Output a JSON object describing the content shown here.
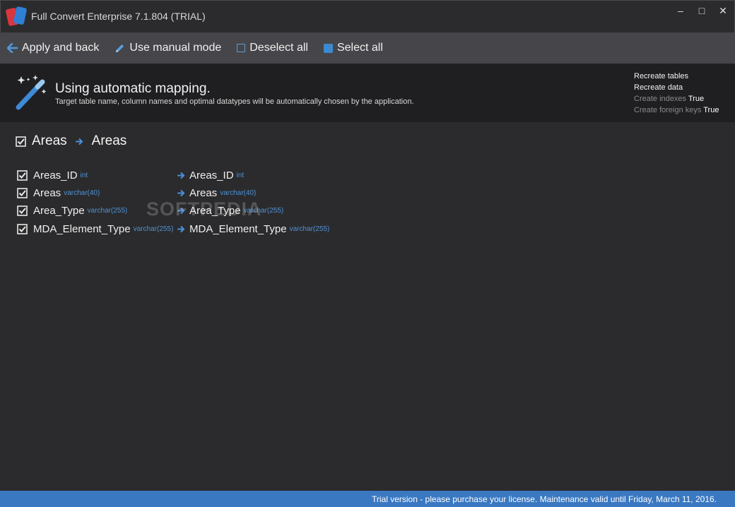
{
  "window": {
    "title": "Full Convert Enterprise 7.1.804 (TRIAL)",
    "controls": {
      "minimize": "–",
      "maximize": "□",
      "close": "✕"
    }
  },
  "toolbar": {
    "apply_label": "Apply and back",
    "manual_label": "Use manual mode",
    "deselect_label": "Deselect all",
    "select_label": "Select all"
  },
  "info": {
    "title": "Using automatic mapping.",
    "description": "Target table name, column names and optimal datatypes will be automatically chosen by the application.",
    "options": [
      {
        "label": "Recreate tables",
        "value": ""
      },
      {
        "label": "Recreate data",
        "value": ""
      },
      {
        "label": "Create indexes",
        "value": "True"
      },
      {
        "label": "Create foreign keys",
        "value": "True"
      }
    ]
  },
  "mapping": {
    "source_table": "Areas",
    "target_table": "Areas",
    "columns": [
      {
        "source": "Areas_ID",
        "source_type": "int",
        "target": "Areas_ID",
        "target_type": "int"
      },
      {
        "source": "Areas",
        "source_type": "varchar(40)",
        "target": "Areas",
        "target_type": "varchar(40)"
      },
      {
        "source": "Area_Type",
        "source_type": "varchar(255)",
        "target": "Area_Type",
        "target_type": "varchar(255)"
      },
      {
        "source": "MDA_Element_Type",
        "source_type": "varchar(255)",
        "target": "MDA_Element_Type",
        "target_type": "varchar(255)"
      }
    ]
  },
  "watermark": "SOFTPEDIA",
  "status": {
    "text": "Trial version - please purchase your license. Maintenance valid until Friday, March 11, 2016."
  },
  "colors": {
    "accent": "#3a78c2",
    "toolbar_bg": "#46464a",
    "window_bg": "#2b2b2d",
    "info_bg": "#1f1f21",
    "datatype": "#4e92d6"
  }
}
